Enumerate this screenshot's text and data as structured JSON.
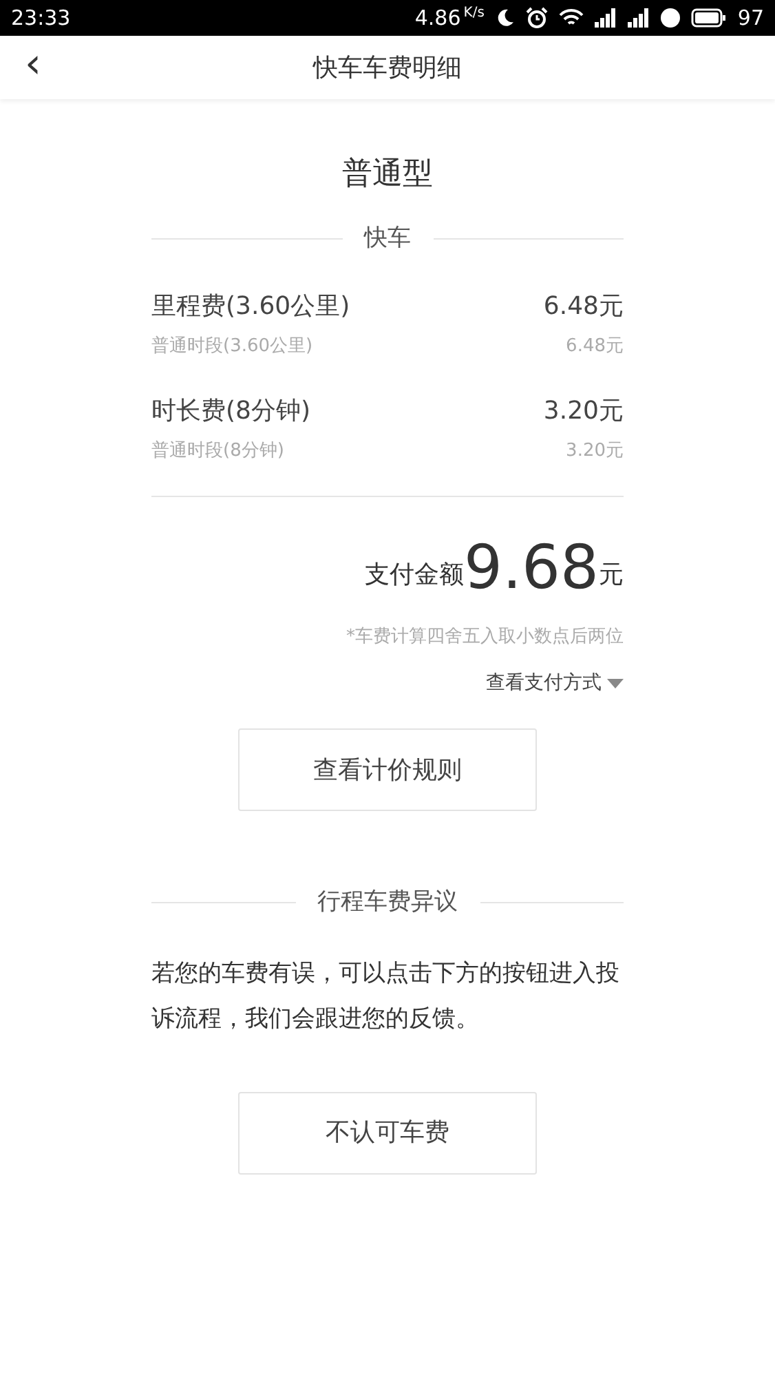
{
  "status_bar": {
    "time": "23:33",
    "speed": "4.86",
    "speed_unit": "K/s",
    "battery": "97"
  },
  "nav": {
    "back": "‹",
    "title": "快车车费明细"
  },
  "car_type": "普通型",
  "section_title": "快车",
  "fees": [
    {
      "name": "里程费(3.60公里)",
      "amount": "6.48元",
      "detail": "普通时段(3.60公里)",
      "detail_amount": "6.48元"
    },
    {
      "name": "时长费(8分钟)",
      "amount": "3.20元",
      "detail": "普通时段(8分钟)",
      "detail_amount": "3.20元"
    }
  ],
  "total": {
    "label": "支付金额",
    "amount": "9.68",
    "unit": "元"
  },
  "note": "*车费计算四舍五入取小数点后两位",
  "payment_link": "查看支付方式",
  "rules_button": "查看计价规则",
  "dispute": {
    "title": "行程车费异议",
    "text": "若您的车费有误，可以点击下方的按钮进入投诉流程，我们会跟进您的反馈。",
    "button": "不认可车费"
  }
}
